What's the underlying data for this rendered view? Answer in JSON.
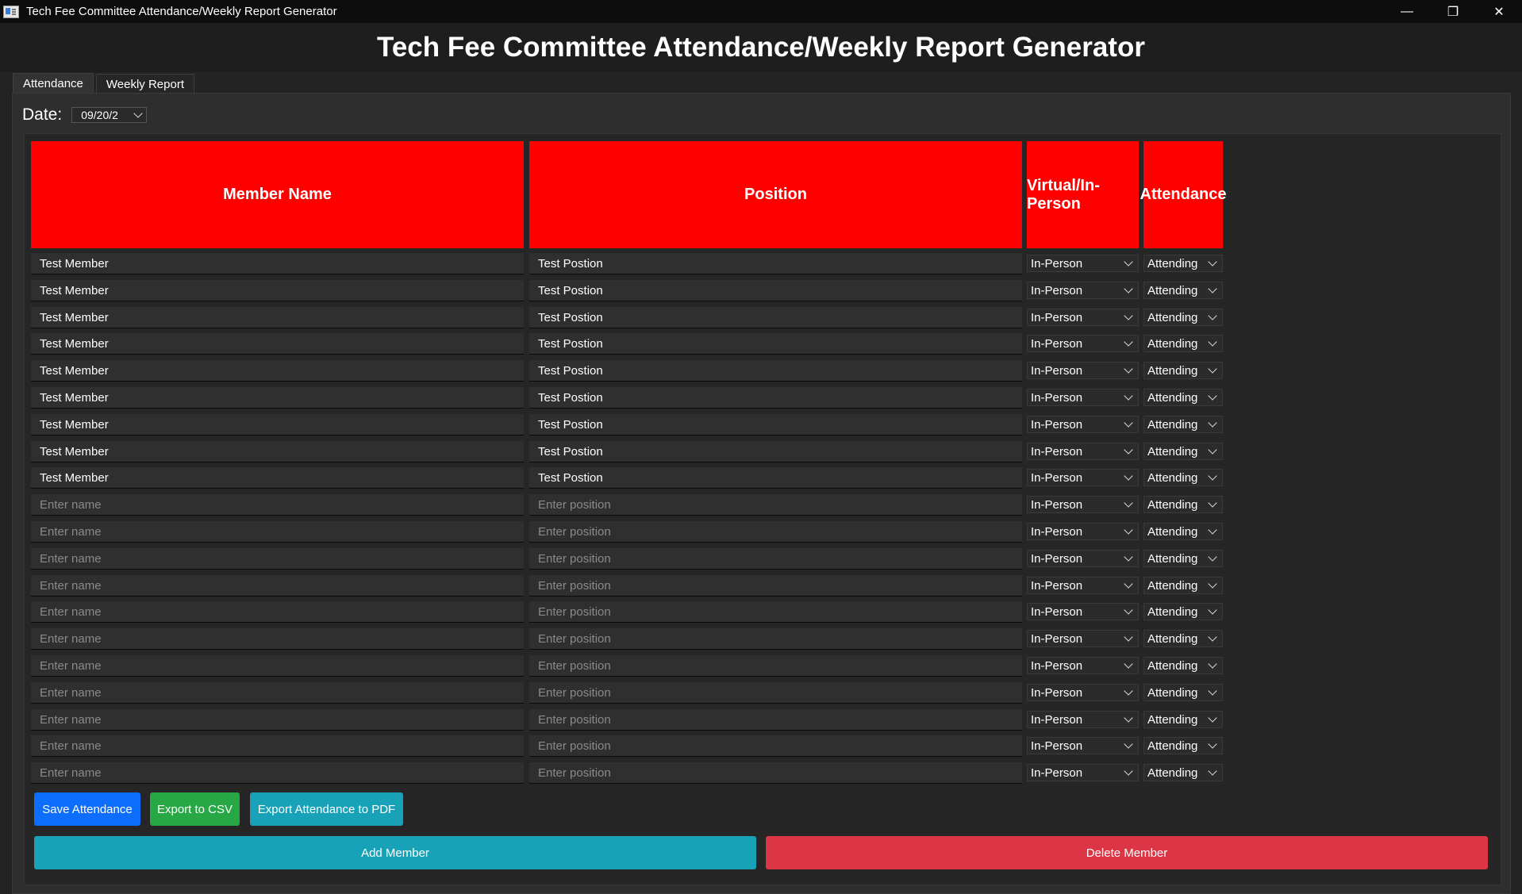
{
  "window": {
    "title": "Tech Fee Committee Attendance/Weekly Report Generator",
    "minimize_glyph": "—",
    "maximize_glyph": "❐",
    "close_glyph": "✕"
  },
  "header": {
    "title": "Tech Fee Committee Attendance/Weekly Report Generator"
  },
  "tabs": [
    {
      "label": "Attendance",
      "active": true
    },
    {
      "label": "Weekly Report",
      "active": false
    }
  ],
  "date": {
    "label": "Date:",
    "value": "09/20/2"
  },
  "table": {
    "headers": [
      "Member Name",
      "Position",
      "Virtual/In-Person",
      "Attendance"
    ],
    "header_color": "#ff0000",
    "name_placeholder": "Enter name",
    "position_placeholder": "Enter position",
    "rows": [
      {
        "name": "Test Member",
        "position": "Test Postion",
        "mode": "In-Person",
        "attendance": "Attending"
      },
      {
        "name": "Test Member",
        "position": "Test Postion",
        "mode": "In-Person",
        "attendance": "Attending"
      },
      {
        "name": "Test Member",
        "position": "Test Postion",
        "mode": "In-Person",
        "attendance": "Attending"
      },
      {
        "name": "Test Member",
        "position": "Test Postion",
        "mode": "In-Person",
        "attendance": "Attending"
      },
      {
        "name": "Test Member",
        "position": "Test Postion",
        "mode": "In-Person",
        "attendance": "Attending"
      },
      {
        "name": "Test Member",
        "position": "Test Postion",
        "mode": "In-Person",
        "attendance": "Attending"
      },
      {
        "name": "Test Member",
        "position": "Test Postion",
        "mode": "In-Person",
        "attendance": "Attending"
      },
      {
        "name": "Test Member",
        "position": "Test Postion",
        "mode": "In-Person",
        "attendance": "Attending"
      },
      {
        "name": "Test Member",
        "position": "Test Postion",
        "mode": "In-Person",
        "attendance": "Attending"
      },
      {
        "name": "",
        "position": "",
        "mode": "In-Person",
        "attendance": "Attending"
      },
      {
        "name": "",
        "position": "",
        "mode": "In-Person",
        "attendance": "Attending"
      },
      {
        "name": "",
        "position": "",
        "mode": "In-Person",
        "attendance": "Attending"
      },
      {
        "name": "",
        "position": "",
        "mode": "In-Person",
        "attendance": "Attending"
      },
      {
        "name": "",
        "position": "",
        "mode": "In-Person",
        "attendance": "Attending"
      },
      {
        "name": "",
        "position": "",
        "mode": "In-Person",
        "attendance": "Attending"
      },
      {
        "name": "",
        "position": "",
        "mode": "In-Person",
        "attendance": "Attending"
      },
      {
        "name": "",
        "position": "",
        "mode": "In-Person",
        "attendance": "Attending"
      },
      {
        "name": "",
        "position": "",
        "mode": "In-Person",
        "attendance": "Attending"
      },
      {
        "name": "",
        "position": "",
        "mode": "In-Person",
        "attendance": "Attending"
      },
      {
        "name": "",
        "position": "",
        "mode": "In-Person",
        "attendance": "Attending"
      }
    ]
  },
  "buttons": {
    "save": {
      "label": "Save Attendance",
      "color": "#0d6efd"
    },
    "csv": {
      "label": "Export to CSV",
      "color": "#28a745"
    },
    "pdf": {
      "label": "Export Attendance to PDF",
      "color": "#17a2b8"
    },
    "add": {
      "label": "Add Member",
      "color": "#17a2b8"
    },
    "delete": {
      "label": "Delete Member",
      "color": "#dc3545"
    }
  }
}
